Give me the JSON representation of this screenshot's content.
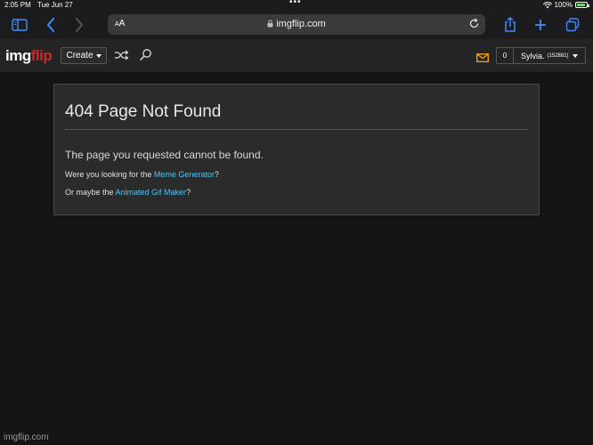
{
  "status_bar": {
    "time": "2:05 PM",
    "date": "Tue Jun 27",
    "battery": "100%",
    "battery_level": 1.0
  },
  "browser": {
    "text_size_label_small": "A",
    "text_size_label": "A",
    "url": "imgflip.com"
  },
  "header": {
    "logo_img": "img",
    "logo_flip": "flip",
    "create_label": "Create",
    "notification_count": "0",
    "user_name": "Sylvia.",
    "user_points": "(152881)",
    "colors": {
      "logo_accent": "#d4262c",
      "mail_icon": "#f39c12",
      "link": "#4fc3f7"
    }
  },
  "error_panel": {
    "title": "404 Page Not Found",
    "message": "The page you requested cannot be found.",
    "line1_prefix": "Were you looking for the ",
    "line1_link": "Meme Generator",
    "line1_suffix": "?",
    "line2_prefix": "Or maybe the ",
    "line2_link": "Animated Gif Maker",
    "line2_suffix": "?"
  },
  "footer": {
    "text": "imgflip.com"
  }
}
